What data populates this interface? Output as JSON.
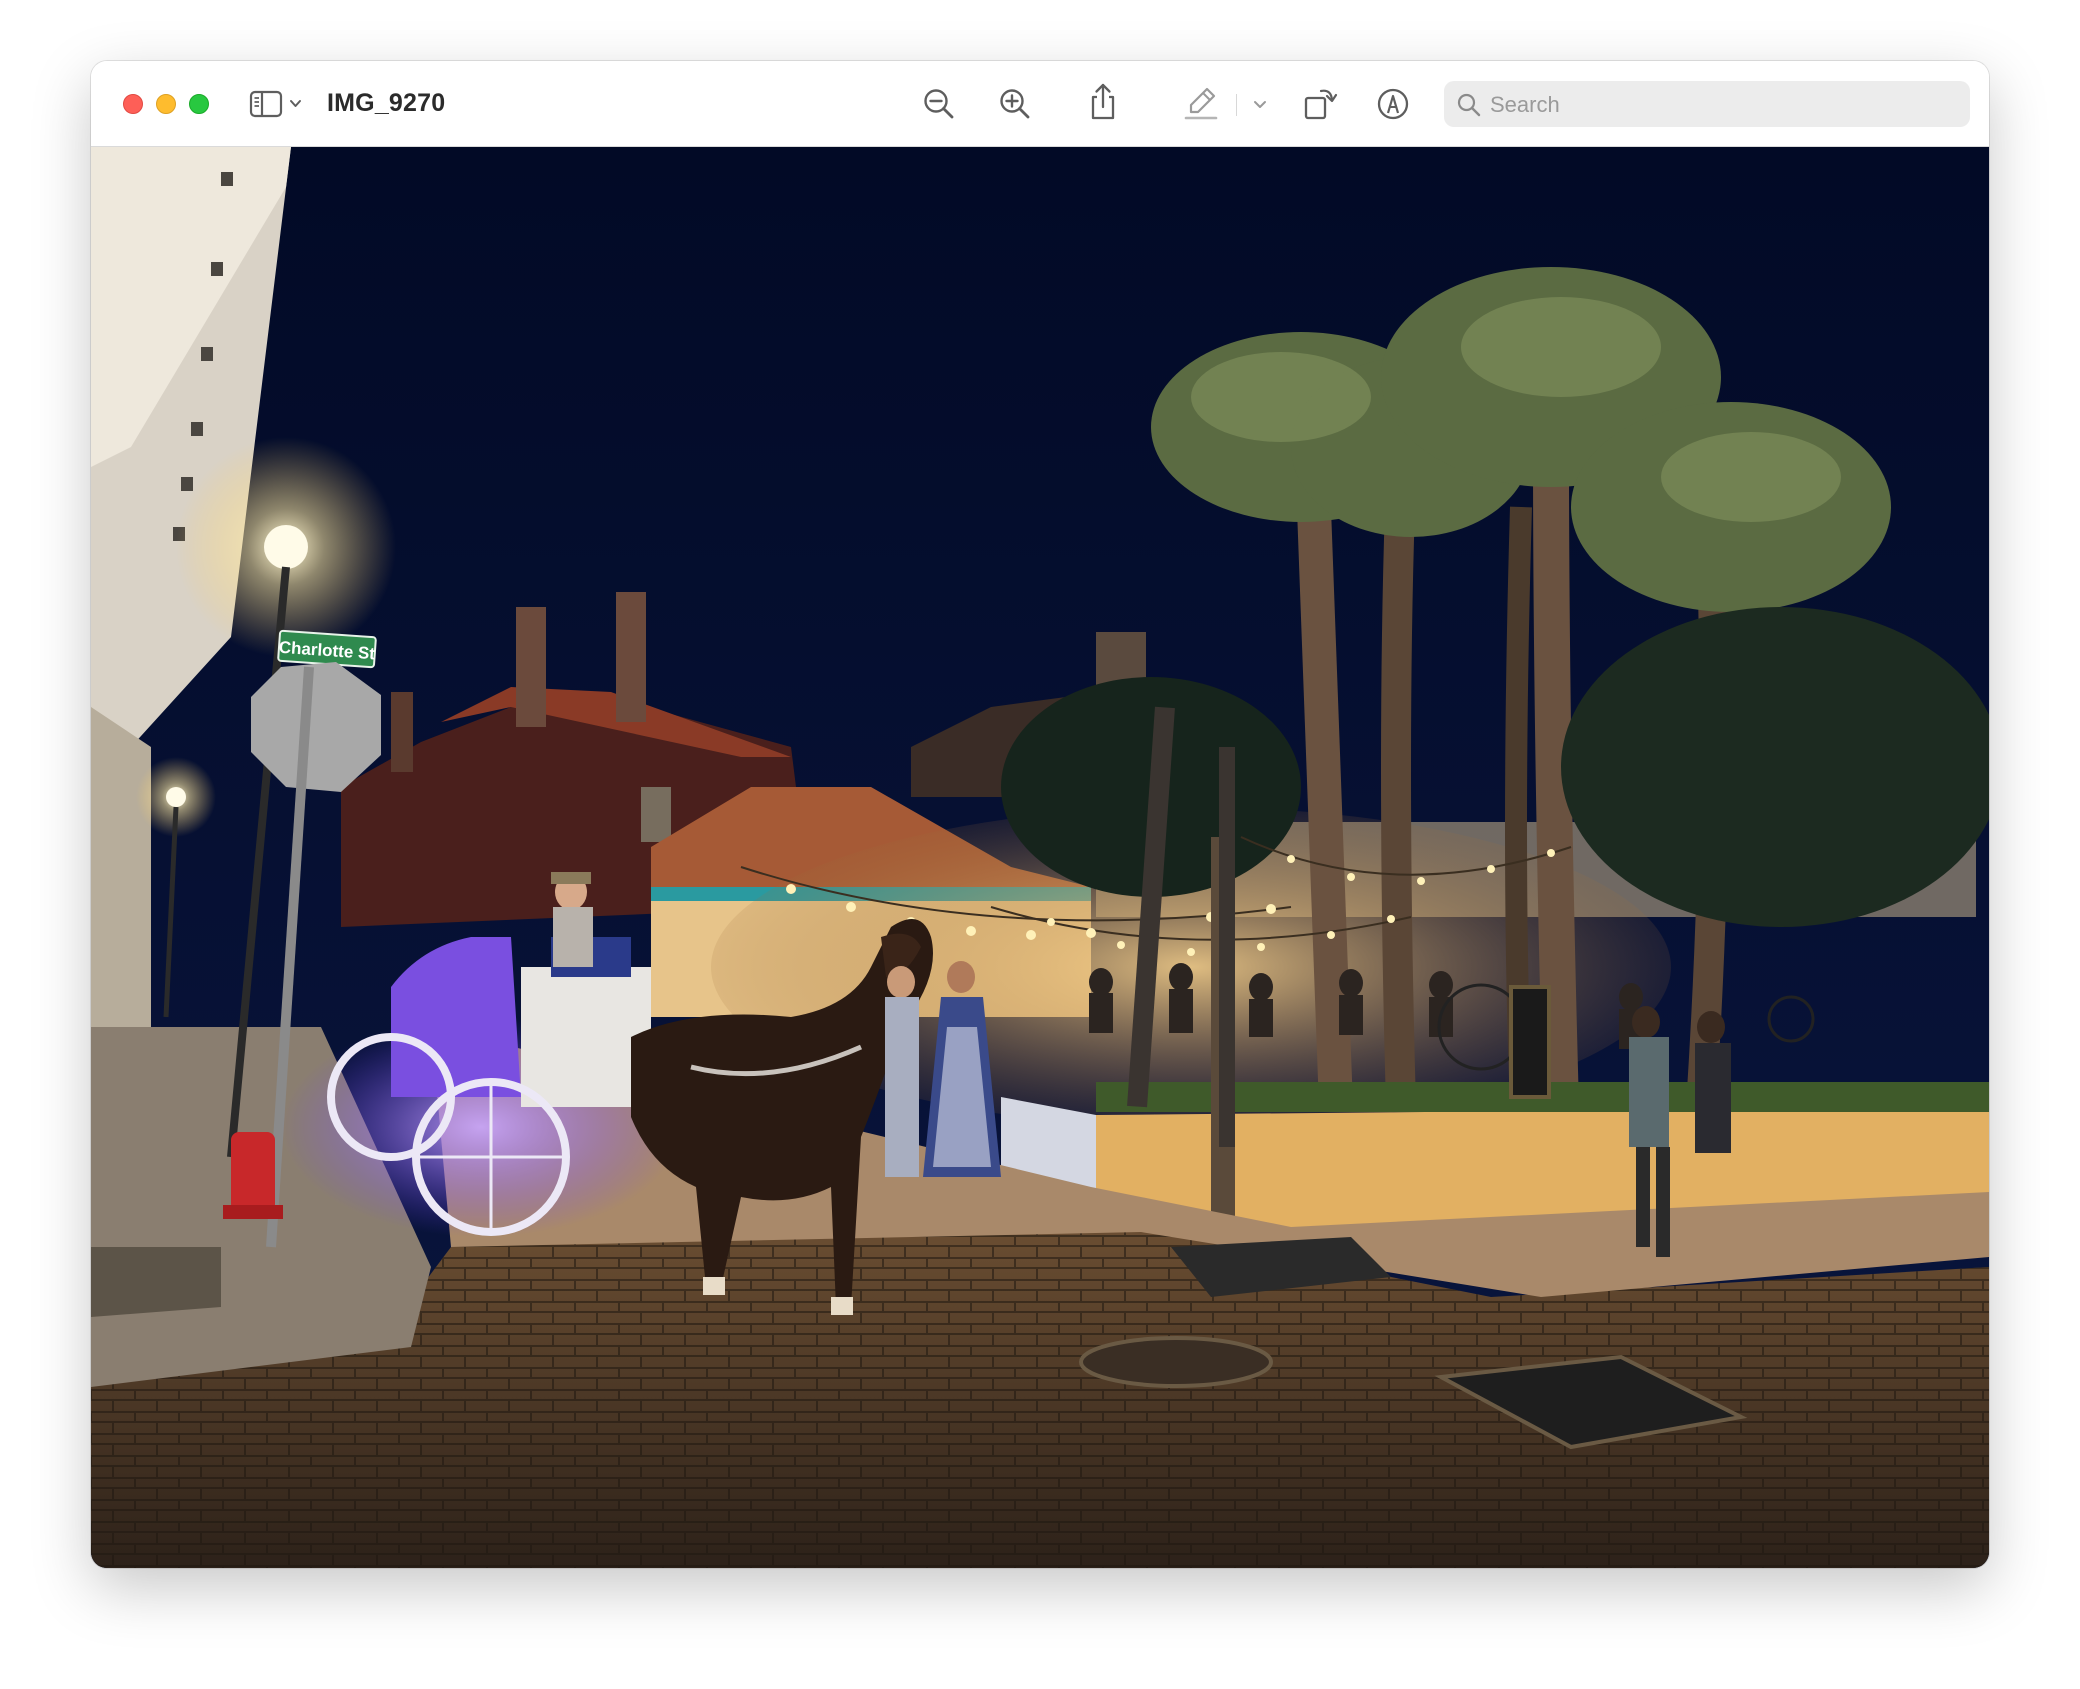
{
  "window": {
    "title": "IMG_9270"
  },
  "toolbar": {
    "buttons": [
      {
        "name": "sidebar-toggle",
        "icon": "sidebar-icon"
      },
      {
        "name": "zoom-out",
        "icon": "zoom-out-icon"
      },
      {
        "name": "zoom-in",
        "icon": "zoom-in-icon"
      },
      {
        "name": "share",
        "icon": "share-icon"
      },
      {
        "name": "highlight",
        "icon": "highlighter-icon"
      },
      {
        "name": "highlight-menu",
        "icon": "chevron-down-icon"
      },
      {
        "name": "rotate",
        "icon": "rotate-icon"
      },
      {
        "name": "markup",
        "icon": "markup-pen-icon"
      }
    ]
  },
  "search": {
    "placeholder": "Search"
  },
  "photo": {
    "street_sign": "Charlotte St"
  },
  "colors": {
    "close": "#fe5f57",
    "minimize": "#febc2e",
    "zoom": "#28c840",
    "toolbar_icon": "#5e5e5e",
    "night_sky": "#030d2b"
  }
}
